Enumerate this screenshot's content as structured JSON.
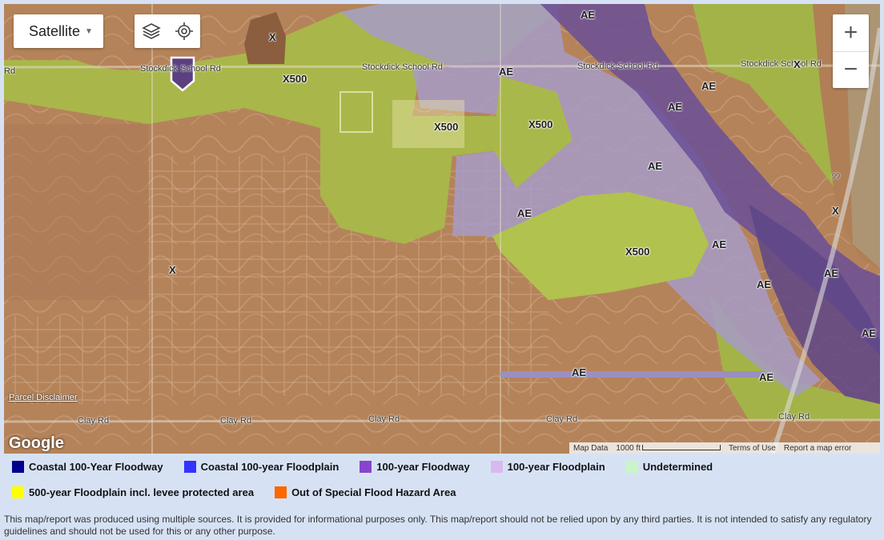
{
  "map": {
    "maptype_label": "Satellite",
    "zoom_in": "+",
    "zoom_out": "−",
    "google_label": "Google",
    "parcel_disclaimer": "Parcel Disclaimer",
    "attribution": {
      "map_data": "Map Data",
      "scale": "1000 ft",
      "terms": "Terms of Use",
      "report": "Report a map error"
    },
    "roads": {
      "stockdick_left": "Stockdick School Rd",
      "stockdick_mid": "Stockdick School Rd",
      "stockdick_mid2": "Stockdick School Rd",
      "stockdick_right": "Stockdick School Rd",
      "clay1": "Clay Rd",
      "clay2": "Clay Rd",
      "clay3": "Clay Rd",
      "clay4": "Clay Rd",
      "clay5": "Clay Rd",
      "rd_left": "Rd",
      "hwy": "99"
    },
    "zones": {
      "x_top": "X",
      "x500_a": "X500",
      "ae_1": "AE",
      "ae_top": "AE",
      "x_right": "X",
      "ae_2": "AE",
      "ae_3": "AE",
      "x500_b": "X500",
      "x500_c": "X500",
      "ae_4": "AE",
      "ae_5": "AE",
      "x_right2": "X",
      "ae_6": "AE",
      "x500_d": "X500",
      "ae_7": "AE",
      "ae_8": "AE",
      "x_left": "X",
      "ae_9": "AE",
      "ae_10": "AE",
      "ae_11": "AE"
    }
  },
  "legend": [
    {
      "label": "Coastal 100-Year Floodway",
      "color": "#00008b"
    },
    {
      "label": "Coastal 100-year Floodplain",
      "color": "#3333ff"
    },
    {
      "label": "100-year Floodway",
      "color": "#8844cc"
    },
    {
      "label": "100-year Floodplain",
      "color": "#d9b8f0"
    },
    {
      "label": "Undetermined",
      "color": "#c8f5c8"
    },
    {
      "label": "500-year Floodplain incl. levee protected area",
      "color": "#ffff00"
    },
    {
      "label": "Out of Special Flood Hazard Area",
      "color": "#ff6600"
    }
  ],
  "disclaimer": "This map/report was produced using multiple sources. It is provided for informational purposes only. This map/report should not be relied upon by any third parties. It is not intended to satisfy any regulatory guidelines and should not be used for this or any other purpose."
}
